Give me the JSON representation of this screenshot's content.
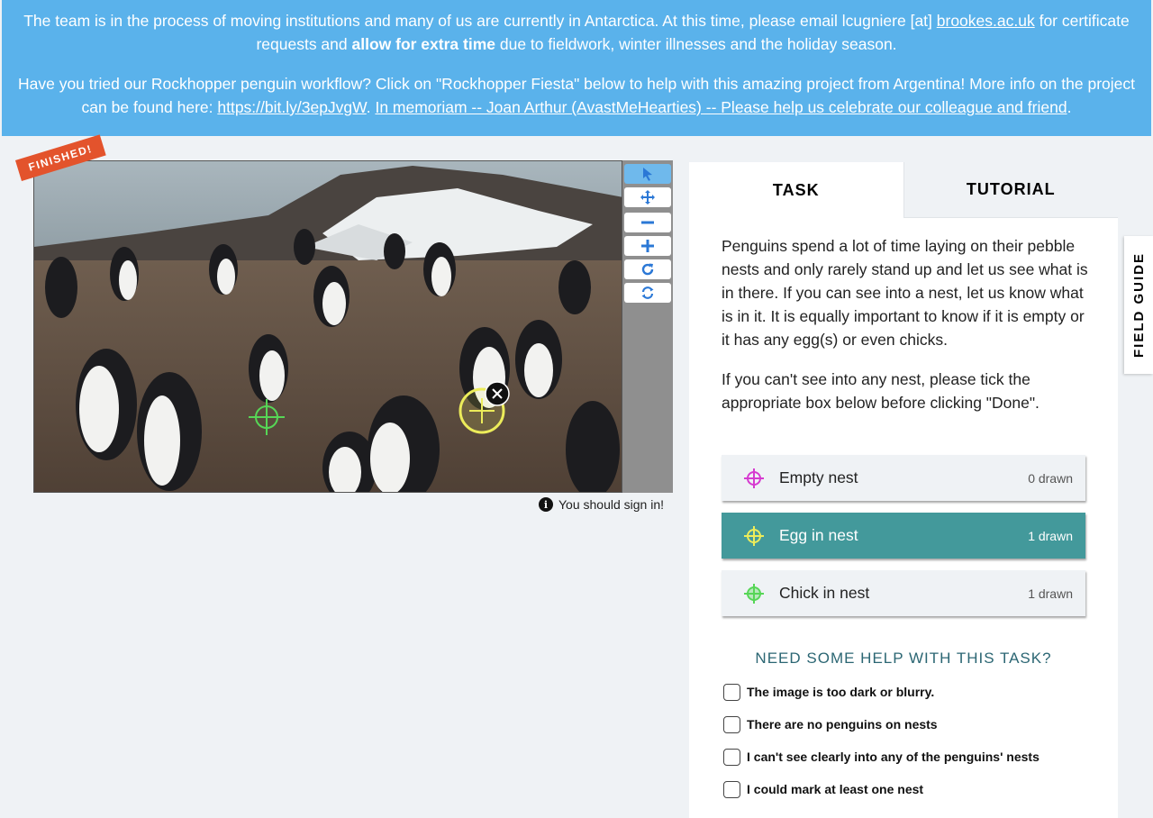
{
  "banner": {
    "p1_before_link": "The team is in the process of moving institutions and many of us are currently in Antarctica. At this time, please email lcugniere [at] ",
    "p1_link": "brookes.ac.uk",
    "p1_middle": " for certificate requests and ",
    "p1_bold": "allow for extra time",
    "p1_after": " due to fieldwork, winter illnesses and the holiday season.",
    "p2_text": "Have you tried our Rockhopper penguin workflow? Click on \"Rockhopper Fiesta\" below to help with this amazing project from Argentina! More info on the project can be found here: ",
    "p2_link1": "https://bit.ly/3epJvgW",
    "p2_sep": ". ",
    "p2_link2": "In memoriam -- Joan Arthur (AvastMeHearties) -- Please help us celebrate our colleague and friend",
    "p2_end": "."
  },
  "viewer": {
    "ribbon": "FINISHED!",
    "signin": "You should sign in!",
    "tools": [
      "pointer-icon",
      "move-icon",
      "zoom-out-icon",
      "zoom-in-icon",
      "rotate-icon",
      "reset-icon"
    ]
  },
  "panel": {
    "tabs": {
      "task": "TASK",
      "tutorial": "TUTORIAL"
    },
    "instructions": {
      "p1": "Penguins spend a lot of time laying on their pebble nests and only rarely stand up and let us see what is in there. If you can see into a nest, let us know what is in it. It is equally important to know if it is empty or it has any egg(s) or even chicks.",
      "p2": "If you can't see into any nest, please tick the appropriate box below before clicking \"Done\"."
    },
    "choices": [
      {
        "label": "Empty nest",
        "count": "0 drawn",
        "color": "#d63bd0"
      },
      {
        "label": "Egg in nest",
        "count": "1 drawn",
        "color": "#ecec5a"
      },
      {
        "label": "Chick in nest",
        "count": "1 drawn",
        "color": "#56d656"
      }
    ],
    "help_title": "NEED SOME HELP WITH THIS TASK?",
    "checkboxes": [
      "The image is too dark or blurry.",
      "There are no penguins on nests",
      "I can't see clearly into any of the penguins' nests",
      "I could mark at least one nest"
    ]
  },
  "field_guide": "FIELD GUIDE",
  "colors": {
    "banner": "#5ab2eb",
    "accent": "#43999b",
    "ribbon": "#e3532c"
  }
}
